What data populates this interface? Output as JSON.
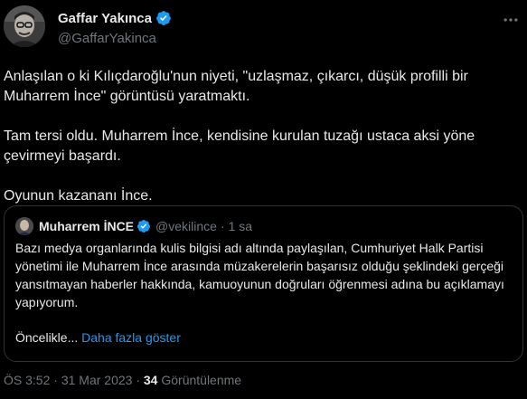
{
  "author": {
    "name": "Gaffar Yakınca",
    "handle": "@GaffarYakinca",
    "avatar_icon": "profile-photo",
    "verified_color": "#1d9bf0"
  },
  "more_icon": "ellipsis-icon",
  "tweet": {
    "paragraphs": [
      "Anlaşılan o ki Kılıçdaroğlu'nun niyeti, \"uzlaşmaz, çıkarcı, düşük profilli bir Muharrem İnce\" görüntüsü yaratmaktı.",
      "Tam tersi oldu. Muharrem İnce, kendisine kurulan tuzağı ustaca aksi yöne çevirmeyi başardı.",
      "Oyunun kazananı İnce."
    ]
  },
  "quoted": {
    "name": "Muharrem İNCE",
    "handle": "@vekilince",
    "time": "1 sa",
    "dot": "·",
    "text": "Bazı medya organlarında kulis bilgisi adı altında paylaşılan, Cumhuriyet Halk Partisi yönetimi ile Muharrem İnce arasında müzakerelerin başarısız olduğu şeklindeki gerçeği yansıtmayan haberler hakkında, kamuoyunun doğruları öğrenmesi adına bu açıklamayı yapıyorum.",
    "teaser": "Öncelikle...",
    "show_more": "Daha fazla göster"
  },
  "meta": {
    "time": "ÖS 3:52",
    "date": "31 Mar 2023",
    "views_count": "34",
    "views_label": "Görüntülenme",
    "separator": "·"
  },
  "colors": {
    "background": "#000000",
    "text": "#e7e9ea",
    "secondary": "#71767b",
    "link": "#1d9bf0",
    "border": "#2f3336"
  }
}
